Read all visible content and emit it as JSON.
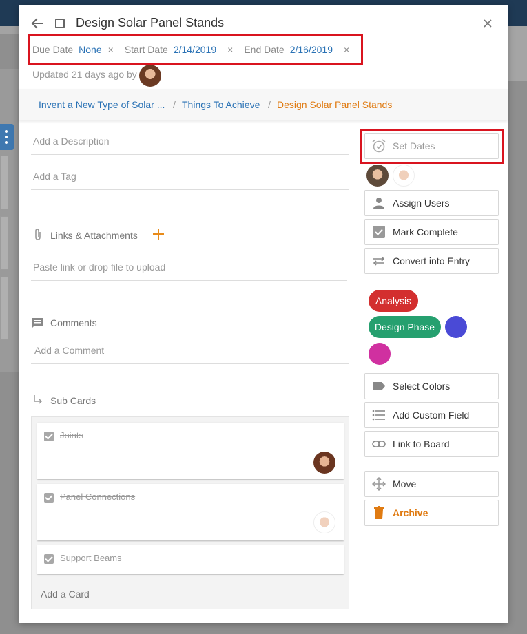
{
  "card": {
    "title": "Design Solar Panel Stands",
    "updated_text": "Updated 21 days ago by"
  },
  "dates": {
    "due_label": "Due Date",
    "due_value": "None",
    "start_label": "Start Date",
    "start_value": "2/14/2019",
    "end_label": "End Date",
    "end_value": "2/16/2019",
    "clear_glyph": "×"
  },
  "breadcrumb": {
    "items": [
      "Invent a New Type of Solar ...",
      "Things To Achieve"
    ],
    "current": "Design Solar Panel Stands",
    "separator": "/"
  },
  "fields": {
    "description_placeholder": "Add a Description",
    "tag_placeholder": "Add a Tag",
    "links_label": "Links & Attachments",
    "links_placeholder": "Paste link or drop file to upload",
    "comments_label": "Comments",
    "comment_placeholder": "Add a Comment",
    "subcards_label": "Sub Cards",
    "add_card": "Add a Card"
  },
  "subcards": [
    {
      "title": "Joints",
      "completed": true
    },
    {
      "title": "Panel Connections",
      "completed": true
    },
    {
      "title": "Support Beams",
      "completed": true
    }
  ],
  "actions": {
    "set_dates": "Set Dates",
    "assign_users": "Assign Users",
    "mark_complete": "Mark Complete",
    "convert_entry": "Convert into Entry",
    "select_colors": "Select Colors",
    "add_custom_field": "Add Custom Field",
    "link_to_board": "Link to Board",
    "move": "Move",
    "archive": "Archive"
  },
  "tags": [
    {
      "label": "Analysis",
      "color": "#d32f2f"
    },
    {
      "label": "Design Phase",
      "color": "#26a06f"
    }
  ],
  "color_dots": [
    "#4a4ad6",
    "#d030a0"
  ],
  "colors": {
    "highlight": "#d9141f",
    "link": "#2a72b5",
    "accent": "#e07b12"
  }
}
